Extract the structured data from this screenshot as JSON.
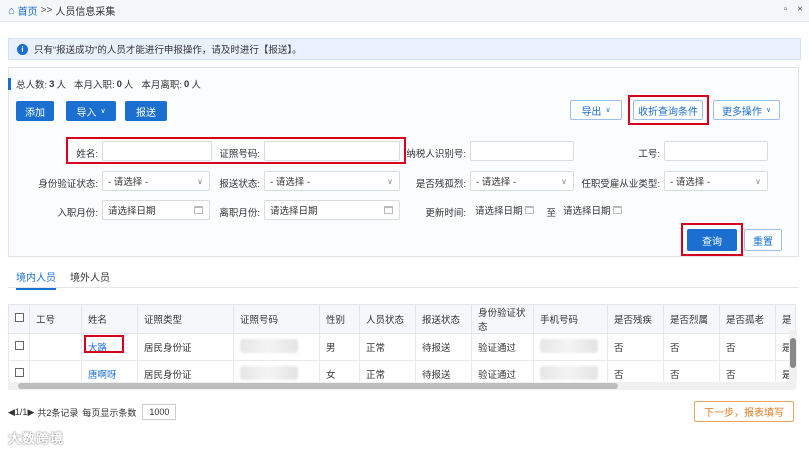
{
  "titlebar": {
    "home": "首页",
    "sep": ">>",
    "current": "人员信息采集",
    "restore": "▫",
    "close": "×"
  },
  "notice": {
    "text": "只有“报送成功”的人员才能进行申报操作，请及时进行【报送】。"
  },
  "stats": {
    "total_label": "总人数:",
    "total_value": "3",
    "total_unit": "人",
    "in_label": "本月入职:",
    "in_value": "0",
    "in_unit": "人",
    "out_label": "本月离职:",
    "out_value": "0",
    "out_unit": "人"
  },
  "toolbar": {
    "add": "添加",
    "import": "导入",
    "submit": "报送",
    "export": "导出",
    "collapse": "收折查询条件",
    "more": "更多操作"
  },
  "filters": {
    "name_label": "姓名:",
    "id_label": "证照号码:",
    "taxid_label": "纳税人识别号:",
    "empno_label": "工号:",
    "verify_label": "身份验证状态:",
    "verify_value": "- 请选择 -",
    "submit_label": "报送状态:",
    "submit_value": "- 请选择 -",
    "disabled_label": "是否残孤烈:",
    "disabled_value": "- 请选择 -",
    "job_label": "任职受雇从业类型:",
    "job_value": "- 请选择 -",
    "hire_label": "入职月份:",
    "hire_value": "请选择日期",
    "leave_label": "离职月份:",
    "leave_value": "请选择日期",
    "update_label": "更新时间:",
    "update_from": "请选择日期",
    "update_to_sep": "至",
    "update_to": "请选择日期",
    "query": "查询",
    "reset": "重置"
  },
  "tabs": [
    "境内人员",
    "境外人员"
  ],
  "table": {
    "columns": [
      "工号",
      "姓名",
      "证照类型",
      "证照号码",
      "性别",
      "人员状态",
      "报送状态",
      "身份验证状态",
      "手机号码",
      "是否残疾",
      "是否烈属",
      "是否孤老",
      "是"
    ],
    "rows": [
      {
        "empno": "",
        "name": "大路",
        "idtype": "居民身份证",
        "idno": "",
        "gender": "男",
        "status": "正常",
        "submit": "待报送",
        "verify": "验证通过",
        "phone": "",
        "disabled": "否",
        "martyr": "否",
        "elderly": "否",
        "more": "是"
      },
      {
        "empno": "",
        "name": "唐啊呀",
        "idtype": "居民身份证",
        "idno": "",
        "gender": "女",
        "status": "正常",
        "submit": "待报送",
        "verify": "验证通过",
        "phone": "",
        "disabled": "否",
        "martyr": "否",
        "elderly": "否",
        "more": "是"
      }
    ]
  },
  "pager": {
    "pages": "1/1",
    "records": "共2条记录",
    "per_page_label": "每页显示条数",
    "per_page": "1000"
  },
  "next_button": "下一步，报表填写",
  "watermark": "大数跨境"
}
